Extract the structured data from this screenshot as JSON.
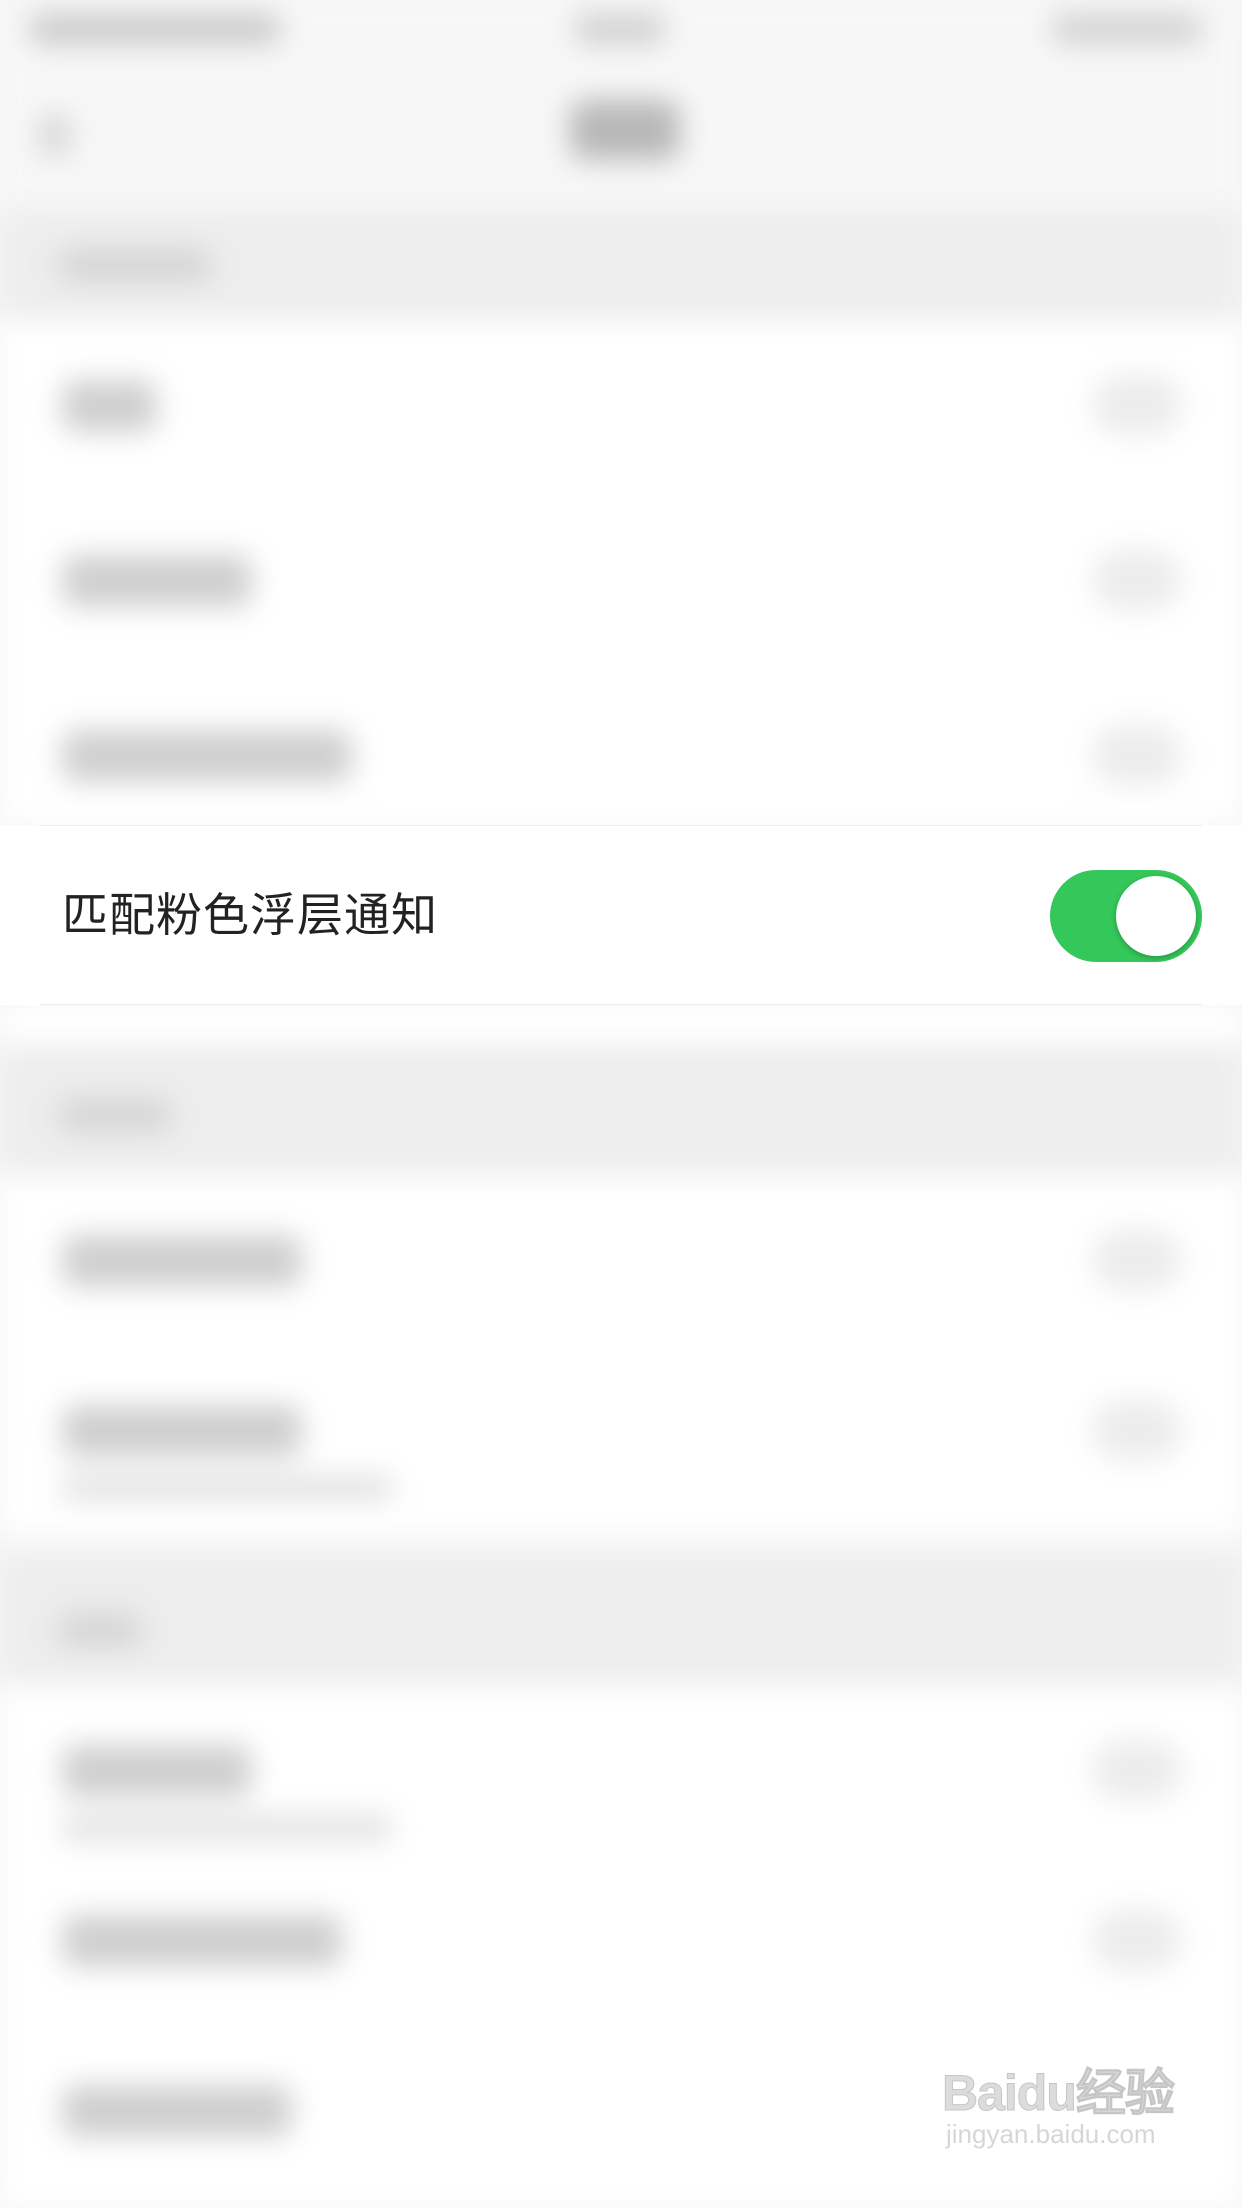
{
  "settings_row": {
    "label": "匹配粉色浮层通知",
    "toggle_on": true
  },
  "colors": {
    "toggle_on": "#34c759",
    "row_text": "#222222",
    "background": "#f6f6f6"
  },
  "watermark": {
    "logo_text": "Baidu经验",
    "url": "jingyan.baidu.com"
  }
}
